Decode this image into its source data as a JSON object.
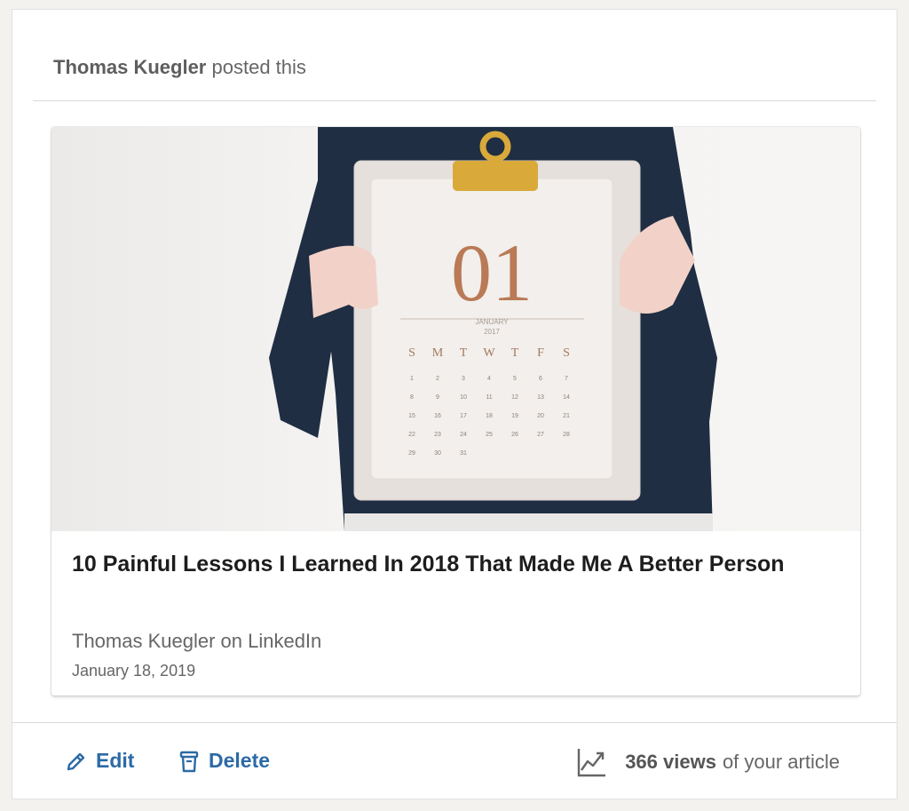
{
  "post": {
    "author": "Thomas Kuegler",
    "action": "posted this"
  },
  "article": {
    "image_alt": "Person holding a clipboard with a January 2017 calendar",
    "image_text": {
      "day": "01",
      "month": "JANUARY",
      "year": "2017",
      "weekdays": [
        "S",
        "M",
        "T",
        "W",
        "T",
        "F",
        "S"
      ]
    },
    "title": "10 Painful Lessons I Learned In 2018 That Made Me A Better Person",
    "source": "Thomas Kuegler on LinkedIn",
    "date": "January 18, 2019"
  },
  "actions": {
    "edit_label": "Edit",
    "delete_label": "Delete",
    "views_count": "366 views",
    "views_suffix": "of your article"
  },
  "colors": {
    "link": "#2c6aa6",
    "sweater": "#1f2e43",
    "clip": "#d9a93a"
  }
}
